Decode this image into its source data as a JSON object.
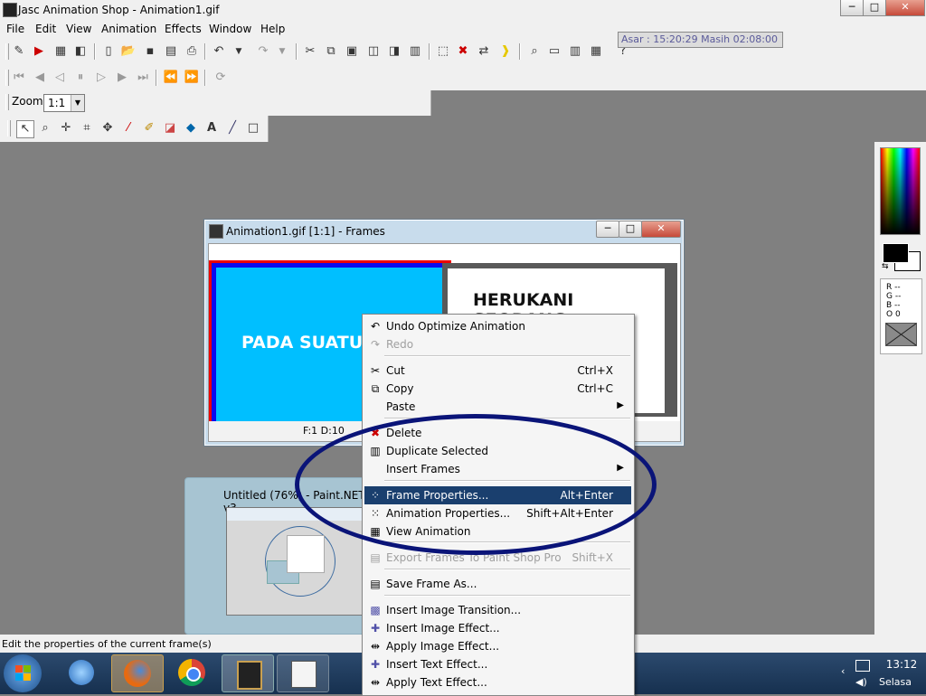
{
  "app": {
    "title": "Jasc Animation Shop - Animation1.gif",
    "controls": [
      "─",
      "□",
      "✕"
    ]
  },
  "menubar": [
    "File",
    "Edit",
    "View",
    "Animation",
    "Effects",
    "Window",
    "Help"
  ],
  "clock_widget": {
    "text": "Asar : 15:20:29  Masih 02:08:00"
  },
  "zoom": {
    "label": "Zoom:",
    "value": "1:1"
  },
  "frames_window": {
    "title": "Animation1.gif [1:1] - Frames",
    "frame1_text": "PADA SUATU H",
    "frame2_text": "HERUKANI SEORANG",
    "frame_info": "F:1  D:10",
    "controls": [
      "─",
      "□",
      "✕"
    ]
  },
  "thumbnail": {
    "title": "Untitled (76%) - Paint.NET v3."
  },
  "color_panel": {
    "r": "R --",
    "g": "G --",
    "b": "B --",
    "o": "O 0"
  },
  "context_menu": {
    "items": [
      {
        "label": "Undo Optimize Animation",
        "shortcut": "",
        "icon": "undo-icon",
        "disabled": false,
        "submenu": false
      },
      {
        "label": "Redo",
        "shortcut": "",
        "icon": "redo-icon",
        "disabled": true,
        "submenu": false
      },
      {
        "label": "Cut",
        "shortcut": "Ctrl+X",
        "icon": "cut-icon",
        "disabled": false,
        "submenu": false
      },
      {
        "label": "Copy",
        "shortcut": "Ctrl+C",
        "icon": "copy-icon",
        "disabled": false,
        "submenu": false
      },
      {
        "label": "Paste",
        "shortcut": "",
        "icon": "paste-icon",
        "disabled": false,
        "submenu": true
      },
      {
        "label": "Delete",
        "shortcut": "",
        "icon": "delete-icon",
        "disabled": false,
        "submenu": false
      },
      {
        "label": "Duplicate Selected",
        "shortcut": "",
        "icon": "duplicate-icon",
        "disabled": false,
        "submenu": false
      },
      {
        "label": "Insert Frames",
        "shortcut": "",
        "icon": "",
        "disabled": false,
        "submenu": true
      },
      {
        "label": "Frame Properties...",
        "shortcut": "Alt+Enter",
        "icon": "frame-properties-icon",
        "disabled": false,
        "submenu": false
      },
      {
        "label": "Animation Properties...",
        "shortcut": "Shift+Alt+Enter",
        "icon": "animation-properties-icon",
        "disabled": false,
        "submenu": false
      },
      {
        "label": "View Animation",
        "shortcut": "",
        "icon": "view-animation-icon",
        "disabled": false,
        "submenu": false
      },
      {
        "label": "Export Frames To Paint Shop Pro",
        "shortcut": "Shift+X",
        "icon": "export-icon",
        "disabled": true,
        "submenu": false
      },
      {
        "label": "Save Frame As...",
        "shortcut": "",
        "icon": "save-frame-icon",
        "disabled": false,
        "submenu": false
      },
      {
        "label": "Insert Image Transition...",
        "shortcut": "",
        "icon": "transition-icon",
        "disabled": false,
        "submenu": false
      },
      {
        "label": "Insert Image Effect...",
        "shortcut": "",
        "icon": "image-effect-icon",
        "disabled": false,
        "submenu": false
      },
      {
        "label": "Apply Image Effect...",
        "shortcut": "",
        "icon": "apply-image-effect-icon",
        "disabled": false,
        "submenu": false
      },
      {
        "label": "Insert Text Effect...",
        "shortcut": "",
        "icon": "text-effect-icon",
        "disabled": false,
        "submenu": false
      },
      {
        "label": "Apply Text Effect...",
        "shortcut": "",
        "icon": "apply-text-effect-icon",
        "disabled": false,
        "submenu": false
      }
    ],
    "selected": "Frame Properties..."
  },
  "statusbar": {
    "text": "Edit the properties of the current frame(s)"
  },
  "taskbar": {
    "time": "13:12",
    "day": "Selasa"
  }
}
